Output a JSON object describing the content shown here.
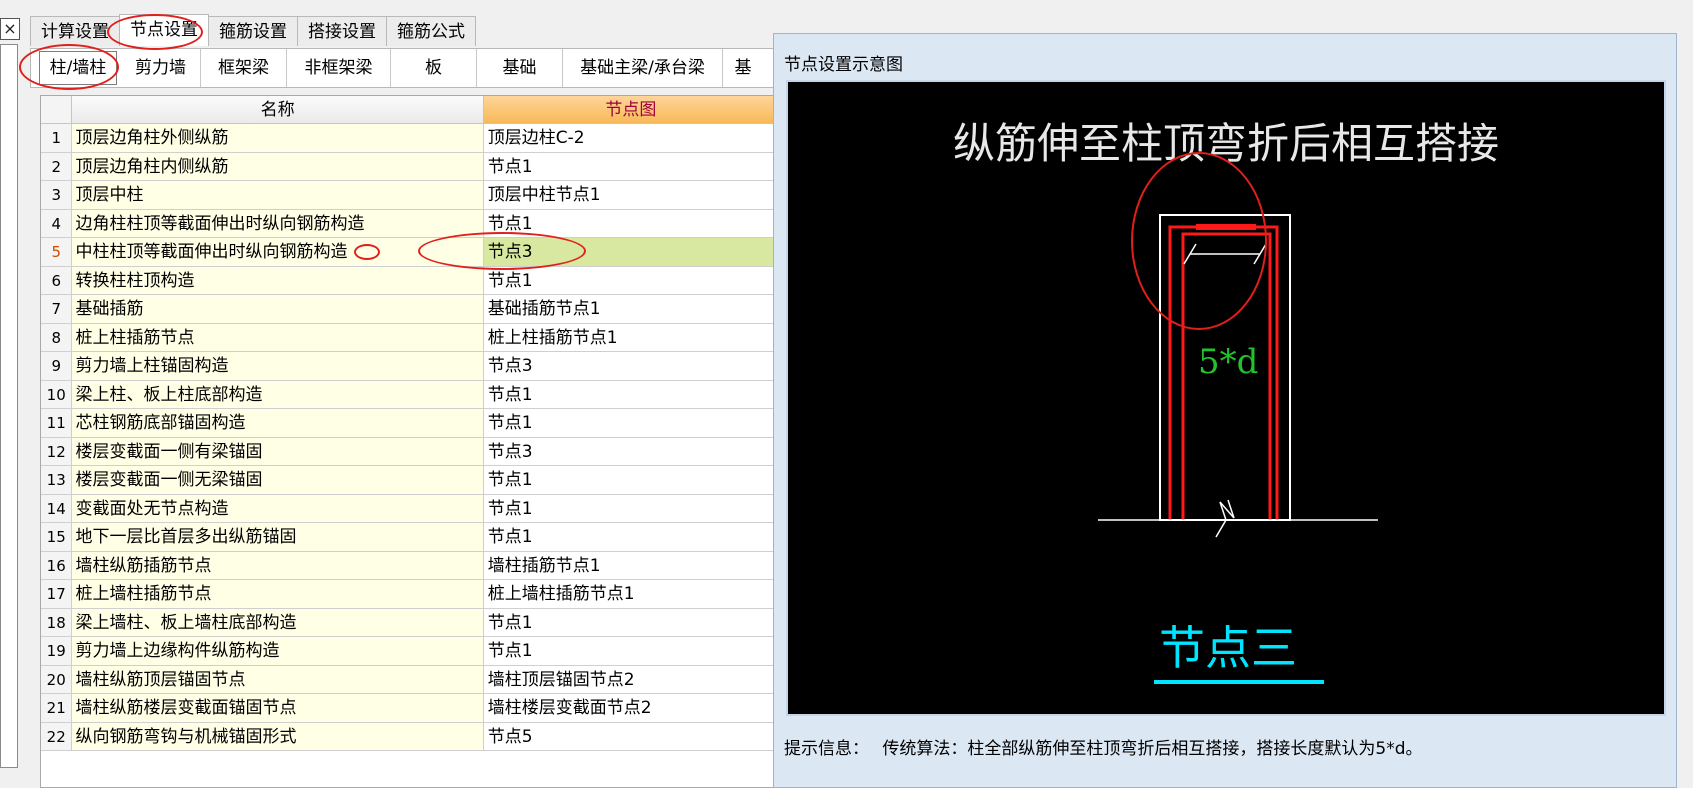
{
  "close_glyph": "×",
  "top_tabs": [
    {
      "label": "计算设置"
    },
    {
      "label": "节点设置"
    },
    {
      "label": "箍筋设置"
    },
    {
      "label": "搭接设置"
    },
    {
      "label": "箍筋公式"
    }
  ],
  "sub_tabs": [
    {
      "label": "柱/墙柱"
    },
    {
      "label": "剪力墙"
    },
    {
      "label": "框架梁"
    },
    {
      "label": "非框架梁"
    },
    {
      "label": "板"
    },
    {
      "label": "基础"
    },
    {
      "label": "基础主梁/承台梁"
    },
    {
      "label": "基"
    }
  ],
  "table": {
    "headers": {
      "name": "名称",
      "node": "节点图"
    },
    "selected_row": 5,
    "rows": [
      {
        "num": "1",
        "name": "顶层边角柱外侧纵筋",
        "node": "顶层边柱C-2"
      },
      {
        "num": "2",
        "name": "顶层边角柱内侧纵筋",
        "node": "节点1"
      },
      {
        "num": "3",
        "name": "顶层中柱",
        "node": "顶层中柱节点1"
      },
      {
        "num": "4",
        "name": "边角柱柱顶等截面伸出时纵向钢筋构造",
        "node": "节点1"
      },
      {
        "num": "5",
        "name": "中柱柱顶等截面伸出时纵向钢筋构造",
        "node": "节点3"
      },
      {
        "num": "6",
        "name": "转换柱柱顶构造",
        "node": "节点1"
      },
      {
        "num": "7",
        "name": "基础插筋",
        "node": "基础插筋节点1"
      },
      {
        "num": "8",
        "name": "桩上柱插筋节点",
        "node": "桩上柱插筋节点1"
      },
      {
        "num": "9",
        "name": "剪力墙上柱锚固构造",
        "node": "节点3"
      },
      {
        "num": "10",
        "name": "梁上柱、板上柱底部构造",
        "node": "节点1"
      },
      {
        "num": "11",
        "name": "芯柱钢筋底部锚固构造",
        "node": "节点1"
      },
      {
        "num": "12",
        "name": "楼层变截面一侧有梁锚固",
        "node": "节点3"
      },
      {
        "num": "13",
        "name": "楼层变截面一侧无梁锚固",
        "node": "节点1"
      },
      {
        "num": "14",
        "name": "变截面处无节点构造",
        "node": "节点1"
      },
      {
        "num": "15",
        "name": "地下一层比首层多出纵筋锚固",
        "node": "节点1"
      },
      {
        "num": "16",
        "name": "墙柱纵筋插筋节点",
        "node": "墙柱插筋节点1"
      },
      {
        "num": "17",
        "name": "桩上墙柱插筋节点",
        "node": "桩上墙柱插筋节点1"
      },
      {
        "num": "18",
        "name": "梁上墙柱、板上墙柱底部构造",
        "node": "节点1"
      },
      {
        "num": "19",
        "name": "剪力墙上边缘构件纵筋构造",
        "node": "节点1"
      },
      {
        "num": "20",
        "name": "墙柱纵筋顶层锚固节点",
        "node": "墙柱顶层锚固节点2"
      },
      {
        "num": "21",
        "name": "墙柱纵筋楼层变截面锚固节点",
        "node": "墙柱楼层变截面节点2"
      },
      {
        "num": "22",
        "name": "纵向钢筋弯钩与机械锚固形式",
        "node": "节点5"
      }
    ]
  },
  "dialog": {
    "title": "节点设置示意图",
    "diagram_title": "纵筋伸至柱顶弯折后相互搭接",
    "dimension_label": "5*d",
    "node_label": "节点三",
    "hint_label": "提示信息：",
    "hint_text": "传统算法：柱全部纵筋伸至柱顶弯折后相互搭接，搭接长度默认为5*d。"
  },
  "colors": {
    "annotation": "#e0201a",
    "rebar": "#ff1a1a",
    "dimension_text": "#22c22e",
    "node_label": "#00e5ff"
  }
}
